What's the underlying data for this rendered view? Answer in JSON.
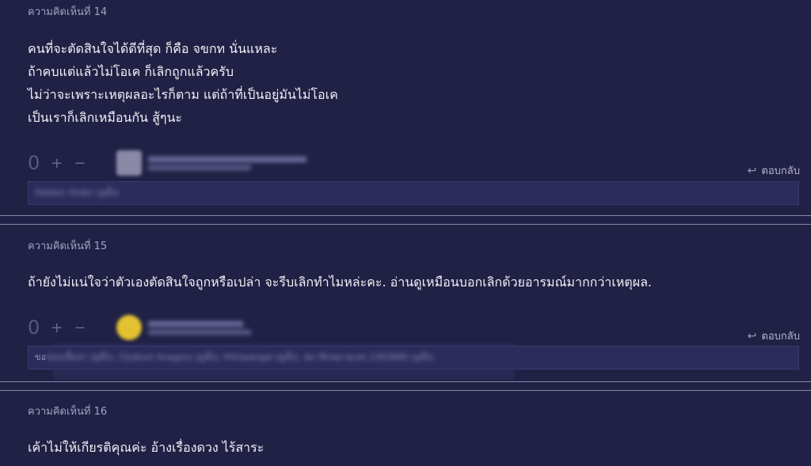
{
  "comments": [
    {
      "label": "ความคิดเห็นที่ 14",
      "lines": [
        "คนที่จะตัดสินใจได้ดีที่สุด ก็คือ จขกท นั่นแหละ",
        "ถ้าคบแต่แล้วไม่โอเค ก็เลิกถูกแล้วครับ",
        "ไม่ว่าจะเพราะเหตุผลอะไรก็ตาม แต่ถ้าที่เป็นอยู่มันไม่โอเค",
        "เป็นเราก็เลิกเหมือนกัน สู้ๆนะ"
      ],
      "vote_count": "0",
      "reply_label": "ตอบกลับ",
      "tag_prefix": "",
      "tags_text": "Hidden Order (ดูทั้ง)"
    },
    {
      "label": "ความคิดเห็นที่ 15",
      "lines": [
        "ถ้ายังไม่แน่ใจว่าตัวเองตัดสินใจถูกหรือเปล่า จะรีบเลิกทำไมหล่ะคะ.  อ่านดูเหมือนบอกเลิกด้วยอารมณ์มากกว่าเหตุผล."
      ],
      "vote_count": "0",
      "reply_label": "ตอบกลับ",
      "tag_prefix": "ขอ",
      "tags_text": "ชอบเนื้อหา (ดูทั้ง), Clydium Imagery (ดูทั้ง), Hiimpangel (ดูทั้ง), สมาชิกหมายเลข 2363880 (ดูทั้ง)"
    },
    {
      "label": "ความคิดเห็นที่ 16",
      "lines": [
        "เค้าไม่ให้เกียรติคุณค่ะ อ้างเรื่องดวง ไร้สาระ"
      ]
    }
  ],
  "icons": {
    "plus": "plus-icon",
    "minus": "minus-icon",
    "reply": "reply-arrow-icon"
  },
  "colors": {
    "background": "#212146",
    "divider": "#8686a6",
    "badge": "#e2c230"
  }
}
